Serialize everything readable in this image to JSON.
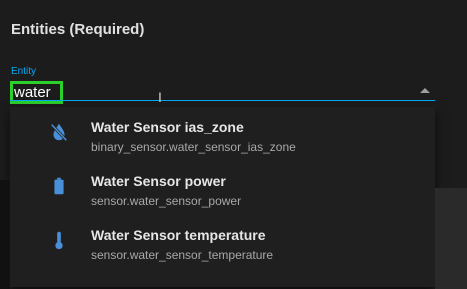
{
  "section": {
    "title": "Entities (Required)"
  },
  "entity_field": {
    "label": "Entity",
    "value": "water"
  },
  "options": [
    {
      "name": "Water Sensor ias_zone",
      "entity_id": "binary_sensor.water_sensor_ias_zone",
      "icon": "water-off-icon"
    },
    {
      "name": "Water Sensor power",
      "entity_id": "sensor.water_sensor_power",
      "icon": "battery-icon"
    },
    {
      "name": "Water Sensor temperature",
      "entity_id": "sensor.water_sensor_temperature",
      "icon": "thermometer-icon"
    }
  ],
  "colors": {
    "accent": "#03a9f4",
    "focus_outline": "#2bd02b",
    "icon": "#4a90d9",
    "background": "#1c1c1c"
  }
}
